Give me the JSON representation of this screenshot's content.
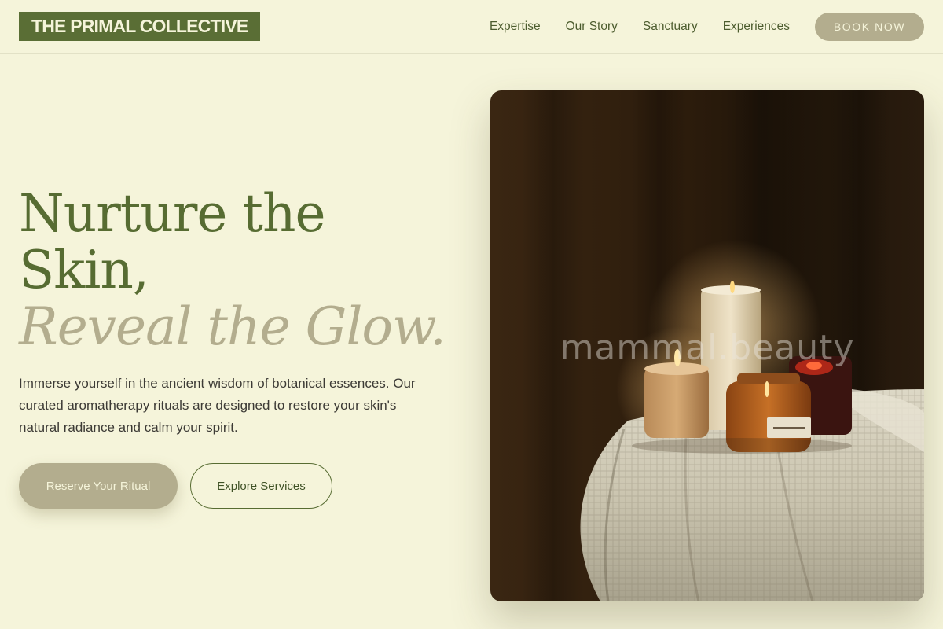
{
  "header": {
    "logo_text": "THE PRIMAL COLLECTIVE",
    "nav": [
      {
        "label": "Expertise"
      },
      {
        "label": "Our Story"
      },
      {
        "label": "Sanctuary"
      },
      {
        "label": "Experiences"
      }
    ],
    "book_label": "BOOK NOW"
  },
  "hero": {
    "title_line1": "Nurture the",
    "title_line2": "Skin,",
    "title_accent": "Reveal the Glow.",
    "description": "Immerse yourself in the ancient wisdom of botanical essences. Our curated aromatherapy rituals are designed to restore your skin's natural radiance and calm your spirit.",
    "primary_button": "Reserve Your Ritual",
    "secondary_button": "Explore Services",
    "image_watermark": "mammal.beauty",
    "image_subject": "candles-on-draped-table"
  },
  "colors": {
    "background": "#f5f4da",
    "brand_green": "#576c32",
    "accent_taupe": "#b3ad8e",
    "text_dark": "#3c3a35"
  }
}
